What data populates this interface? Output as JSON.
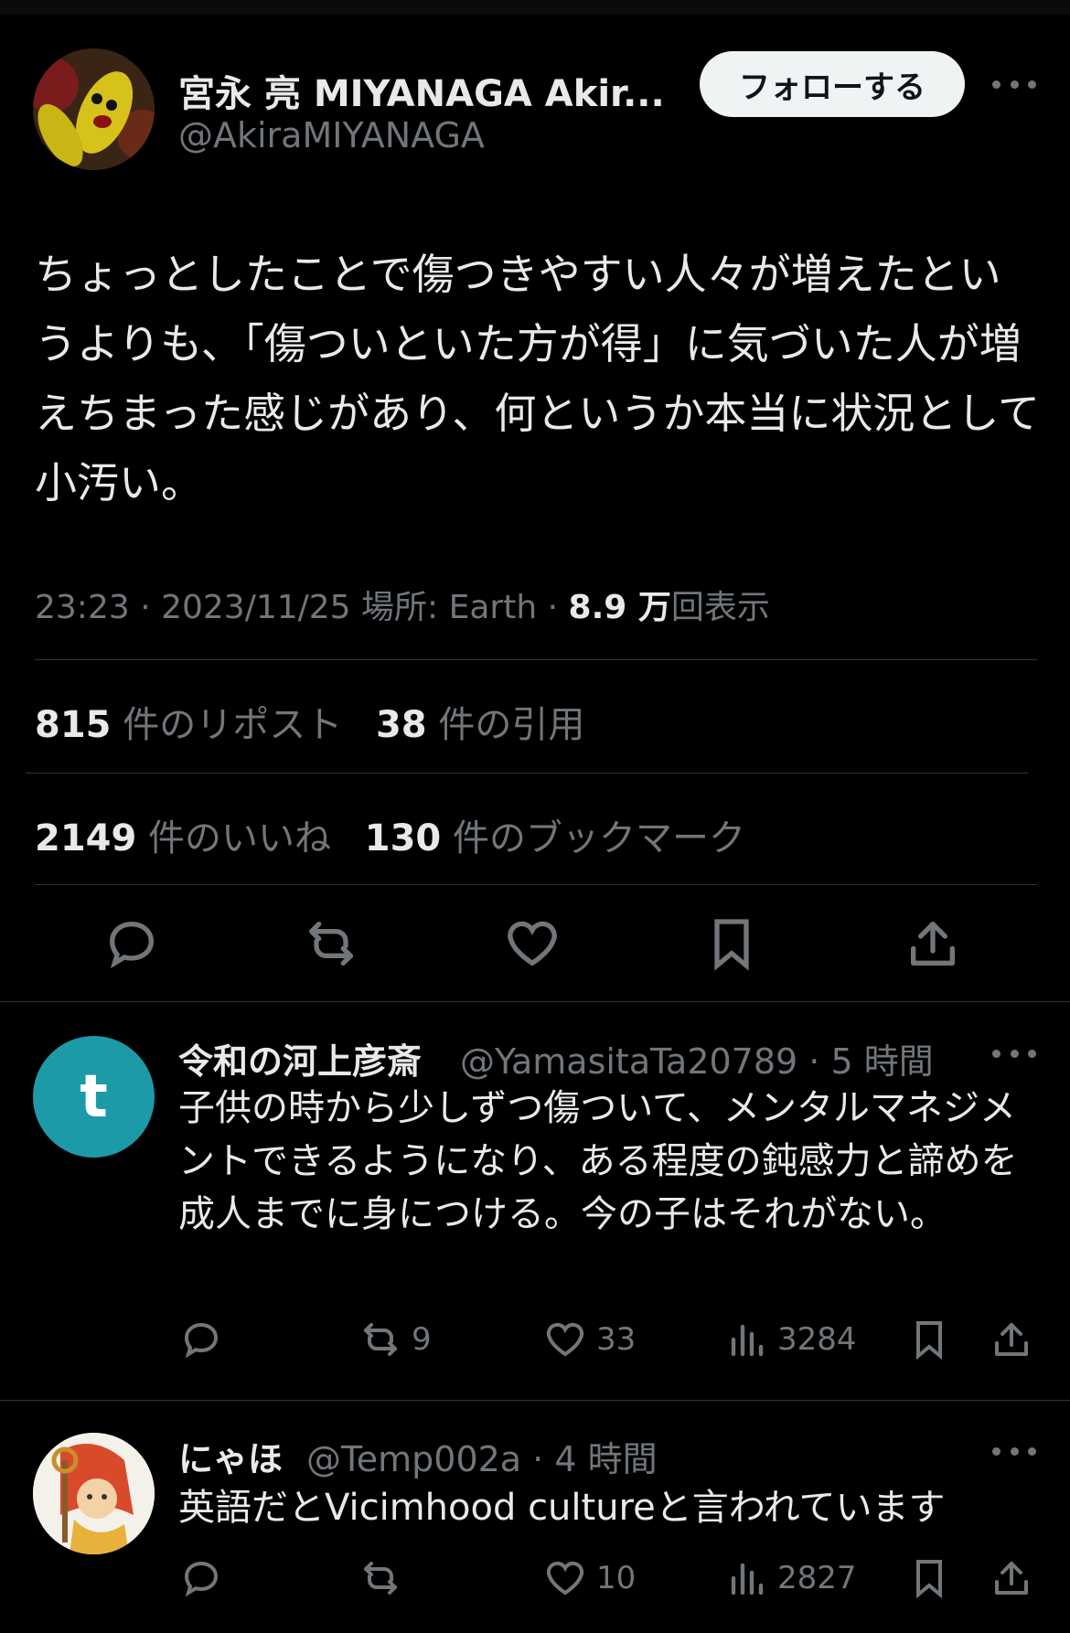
{
  "tweet": {
    "author_name": "宮永 亮 MIYANAGA Akir...",
    "author_handle": "@AkiraMIYANAGA",
    "follow_label": "フォローする",
    "text": "ちょっとしたことで傷つきやすい人々が増えたというよりも、「傷ついといた方が得」に気づいた人が増えちまった感じがあり、何というか本当に状況として小汚い。",
    "time": "23:23 · 2023/11/25",
    "location": "場所: Earth",
    "sep": "·",
    "views_num": "8.9 万",
    "views_label": "回表示",
    "reposts_num": "815",
    "reposts_label": "件のリポスト",
    "quotes_num": "38",
    "quotes_label": "件の引用",
    "likes_num": "2149",
    "likes_label": "件のいいね",
    "bookmarks_num": "130",
    "bookmarks_label": "件のブックマーク"
  },
  "replies": [
    {
      "avatar_letter": "t",
      "avatar_color": "#1d9aa8",
      "name": "令和の河上彦斎",
      "handle_time": "@YamasitaTa20789 · 5 時間",
      "text": "子供の時から少しずつ傷ついて、メンタルマネジメントできるようになり、ある程度の鈍感力と諦めを成人までに身につける。今の子はそれがない。",
      "retweets": "9",
      "likes": "33",
      "views": "3284"
    },
    {
      "name": "にゃほ",
      "handle_time": "@Temp002a · 4 時間",
      "text": "英語だとVicimhood cultureと言われています",
      "retweets": "",
      "likes": "10",
      "views": "2827"
    }
  ],
  "icons": {
    "reply": "reply-icon",
    "retweet": "retweet-icon",
    "like": "heart-icon",
    "bookmark": "bookmark-icon",
    "share": "share-icon",
    "views": "views-icon",
    "more": "more-icon"
  },
  "colors": {
    "background": "#000000",
    "text": "#e7e9ea",
    "secondary": "#71767b",
    "divider": "#2f3336",
    "follow_bg": "#eff3f4"
  }
}
